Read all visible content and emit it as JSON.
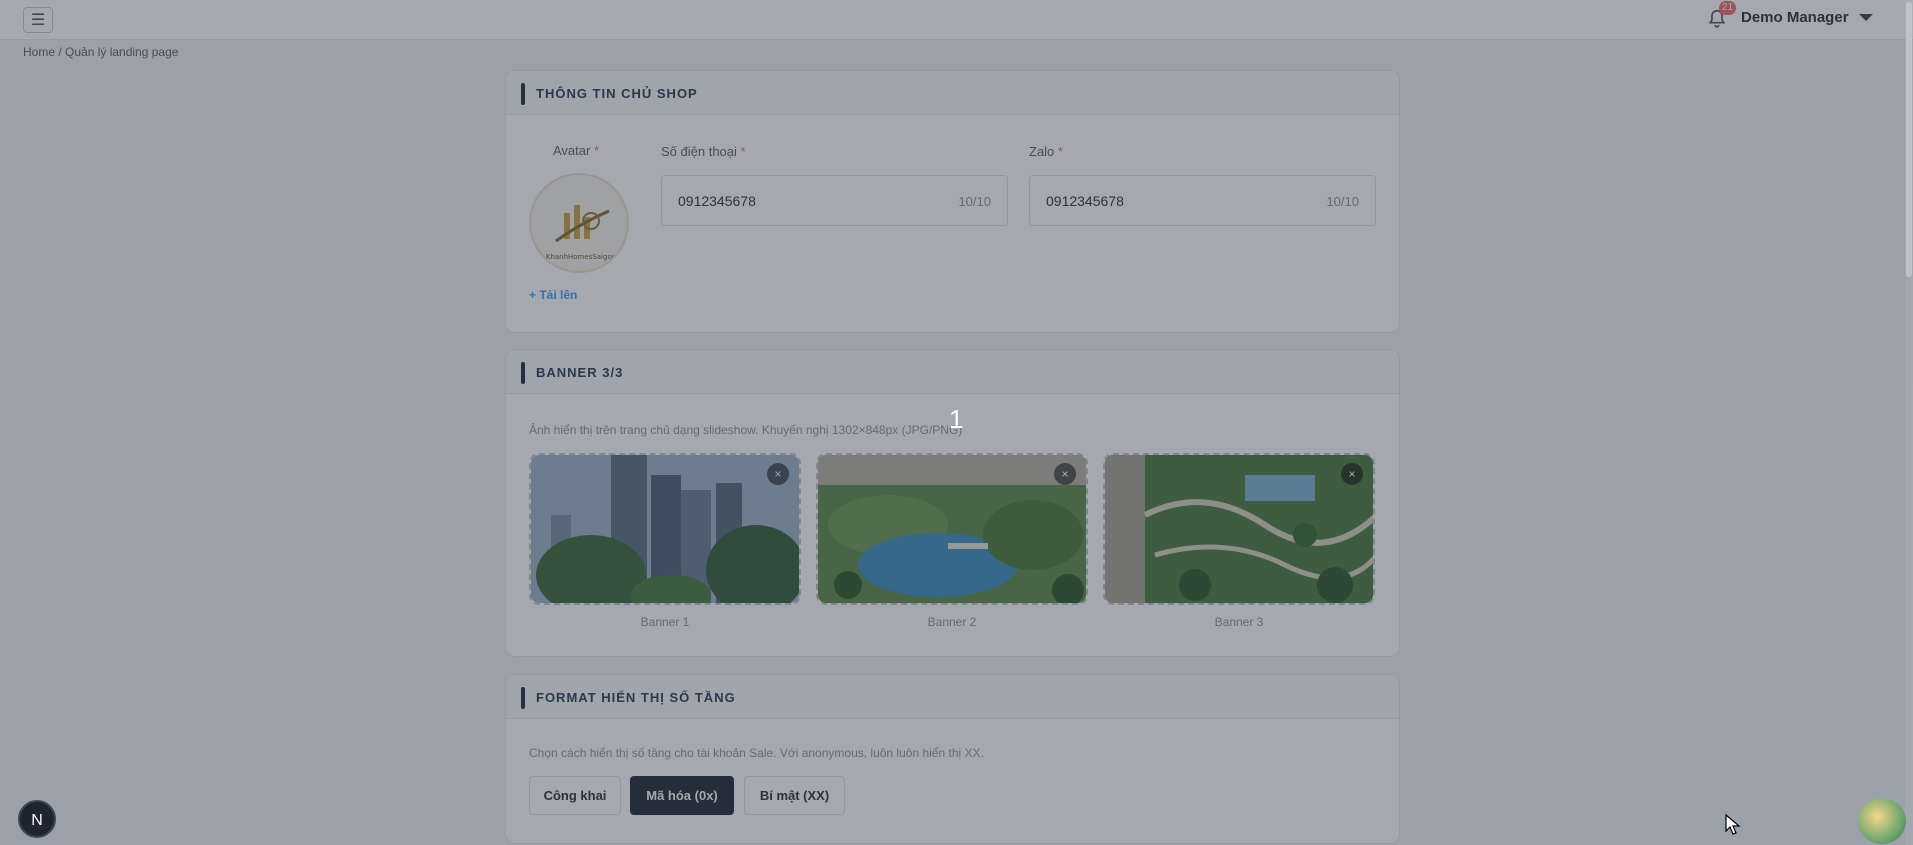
{
  "header": {
    "menu_icon": "hamburger-icon",
    "notification_count": "21",
    "user_name": "Demo Manager"
  },
  "breadcrumb": "Home / Quản lý landing page",
  "owner_card": {
    "title": "THÔNG TIN CHỦ SHOP",
    "avatar_label": "Avatar",
    "avatar_logo_text": "KhanhHomesSaigon",
    "upload_label": "+ Tải lên",
    "phone_label": "Số điện thoại",
    "phone_value": "0912345678",
    "phone_count": "10/10",
    "zalo_label": "Zalo",
    "zalo_value": "0912345678",
    "zalo_count": "10/10",
    "required_mark": "*"
  },
  "banner_card": {
    "title": "BANNER 3/3",
    "hint": "Ảnh hiển thị trên trang chủ dạng slideshow. Khuyến nghị 1302×848px (JPG/PNG)",
    "items": [
      {
        "caption": "Banner 1"
      },
      {
        "caption": "Banner 2"
      },
      {
        "caption": "Banner 3"
      }
    ],
    "close_glyph": "×"
  },
  "format_card": {
    "title": "FORMAT HIỂN THỊ SỐ TẦNG",
    "hint": "Chọn cách hiển thị số tầng cho tài khoản Sale. Với anonymous, luôn luôn hiển thị XX.",
    "options": [
      "Công khai",
      "Mã hóa (0x)",
      "Bí mật (XX)"
    ],
    "selected": "Mã hóa (0x)"
  },
  "overlay": {
    "counter": "1"
  },
  "floating": {
    "next_badge": "N"
  },
  "colors": {
    "accent": "#409eff",
    "active_button": "#222a35",
    "danger": "#f56c6c"
  }
}
